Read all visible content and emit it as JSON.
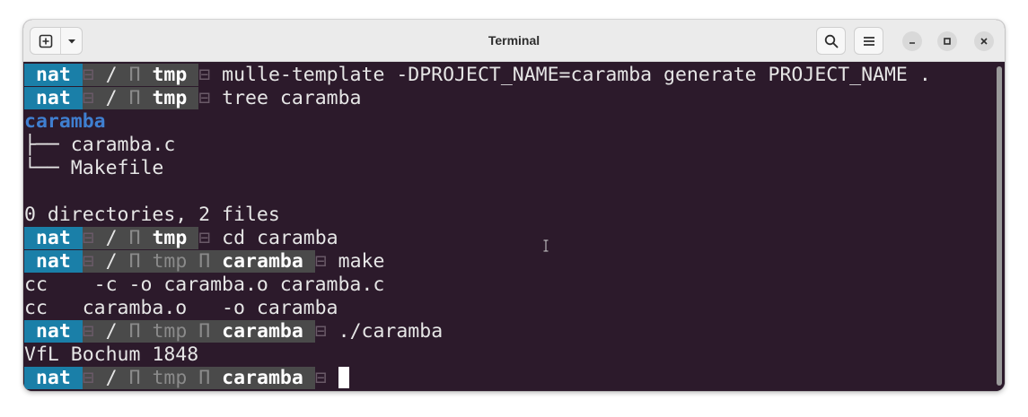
{
  "window": {
    "title": "Terminal"
  },
  "icons": {
    "new_tab": "plus-in-square-icon",
    "tab_menu": "chevron-down-icon",
    "search": "search-icon",
    "menu": "hamburger-menu-icon",
    "minimize": "minimize-icon",
    "maximize": "maximize-icon",
    "close": "close-icon"
  },
  "colors": {
    "terminal_bg": "#2c1a2b",
    "prompt_user_bg": "#1a7fa8",
    "prompt_path_bg": "#4a4a4a",
    "directory": "#3f7fd0",
    "text": "#e6e6e6"
  },
  "prompt": {
    "user": "nat",
    "sep": "⊟",
    "root": "/",
    "pi": "Π",
    "dir_tmp": "tmp",
    "dir_caramba": "caramba"
  },
  "lines": {
    "cmd1": "mulle-template -DPROJECT_NAME=caramba generate PROJECT_NAME .",
    "cmd2": "tree caramba",
    "tree_root": "caramba",
    "tree_item1": "├── caramba.c",
    "tree_item2": "└── Makefile",
    "summary": "0 directories, 2 files",
    "cmd3": "cd caramba",
    "cmd4": "make",
    "out1": "cc    -c -o caramba.o caramba.c",
    "out2": "cc   caramba.o   -o caramba",
    "cmd5": "./caramba",
    "out3": "VfL Bochum 1848"
  }
}
